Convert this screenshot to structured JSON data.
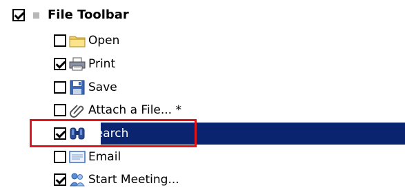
{
  "group": {
    "label": "File Toolbar",
    "checked": true
  },
  "items": [
    {
      "label": "Open",
      "checked": false,
      "icon": "folder-icon"
    },
    {
      "label": "Print",
      "checked": true,
      "icon": "printer-icon"
    },
    {
      "label": "Save",
      "checked": false,
      "icon": "floppy-disk-icon"
    },
    {
      "label": "Attach a File... *",
      "checked": false,
      "icon": "paperclip-icon"
    },
    {
      "label": "Search",
      "checked": true,
      "icon": "binoculars-icon",
      "selected": true
    },
    {
      "label": "Email",
      "checked": false,
      "icon": "email-icon"
    },
    {
      "label": "Start Meeting...",
      "checked": true,
      "icon": "people-meeting-icon"
    }
  ],
  "colors": {
    "selection": "#0b2470",
    "highlight": "#e0141b"
  }
}
